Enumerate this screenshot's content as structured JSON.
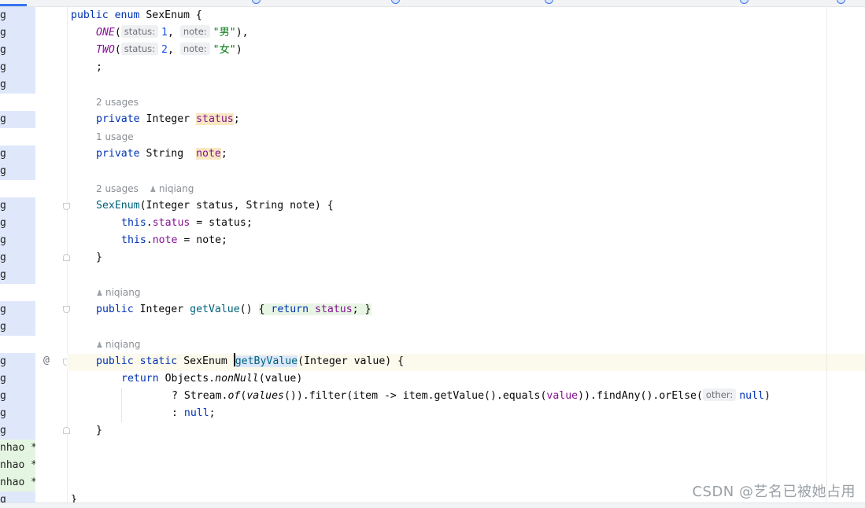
{
  "code": {
    "l1": {
      "kw1": "public",
      "kw2": "enum",
      "name": "SexEnum",
      "brace": " {"
    },
    "l2": {
      "name": "ONE",
      "open": "(",
      "hint_status": "status:",
      "num": "1",
      "comma": ",",
      "hint_note": "note:",
      "str": "\"男\"",
      "close": "),"
    },
    "l3": {
      "name": "TWO",
      "open": "(",
      "hint_status": "status:",
      "num": "2",
      "comma": ",",
      "hint_note": "note:",
      "str": "\"女\"",
      "close": ")"
    },
    "l4": {
      "text": ";"
    },
    "usage1": "2 usages",
    "l5": {
      "kw": "private",
      "type": "Integer",
      "field": "status",
      "end": ";"
    },
    "usage2": "1 usage",
    "l6": {
      "kw": "private",
      "type": "String",
      "field": "note",
      "end": ";"
    },
    "usage3": "2 usages",
    "author3": "niqiang",
    "l7": {
      "name": "SexEnum",
      "params": "(Integer status, String note) {"
    },
    "l8": {
      "kw": "this",
      "dot": ".",
      "field": "status",
      "rest": " = status;"
    },
    "l9": {
      "kw": "this",
      "dot": ".",
      "field": "note",
      "rest": " = note;"
    },
    "l10": {
      "text": "}"
    },
    "author4": "niqiang",
    "l11": {
      "kw": "public",
      "type": "Integer",
      "name": "getValue",
      "parens": "()",
      "open": "{",
      "kw2": "return",
      "field": "status",
      "semi": ";",
      "close": "}"
    },
    "author5": "niqiang",
    "l12": {
      "kw1": "public",
      "kw2": "static",
      "type": "SexEnum",
      "name": "getByValue",
      "params": "(Integer value) {"
    },
    "l13": {
      "kw": "return",
      "obj": "Objects.",
      "call": "nonNull",
      "args": "(value)"
    },
    "l14": {
      "q": "? Stream.",
      "of": "of",
      "p1": "(",
      "values": "values",
      "p2": "()).filter(item -> item.getValue().equals(",
      "param": "value",
      "p3": ")).findAny().orElse(",
      "hint_other": "other:",
      "nullkw": "null",
      "p4": ")"
    },
    "l15": {
      "colon": ": ",
      "nullkw": "null",
      "semi": ";"
    },
    "l16": {
      "text": "}"
    },
    "l17": {
      "text": "}"
    }
  },
  "annotations": [
    "g",
    "g",
    "g",
    "g",
    "g",
    "g",
    "g",
    "g",
    "g",
    "g",
    "g",
    "g",
    "g",
    "g",
    "g",
    "g",
    "g",
    "g",
    "g",
    "g",
    "nhao *",
    "nhao *",
    "nhao *",
    "g"
  ],
  "gutter": {
    "at_marker": "@"
  },
  "watermark": "CSDN @艺名已被她占用",
  "colors": {
    "keyword": "#0033b3",
    "field": "#871094",
    "string": "#067d17",
    "number": "#1750eb",
    "method": "#00627a"
  }
}
